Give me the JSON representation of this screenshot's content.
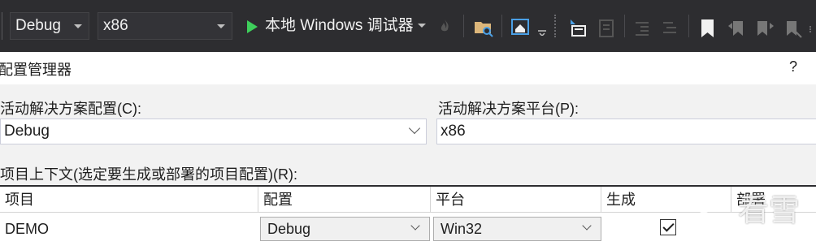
{
  "toolbar": {
    "config_value": "Debug",
    "platform_value": "x86",
    "run_label": "本地 Windows 调试器"
  },
  "dialog": {
    "title": "配置管理器",
    "help": "?",
    "active_config_label": "活动解决方案配置(C):",
    "active_config_value": "Debug",
    "active_platform_label": "活动解决方案平台(P):",
    "active_platform_value": "x86",
    "project_context_label": "项目上下文(选定要生成或部署的项目配置)(R):",
    "columns": [
      "项目",
      "配置",
      "平台",
      "生成",
      "部署"
    ],
    "rows": [
      {
        "project": "DEMO",
        "config": "Debug",
        "platform": "Win32",
        "build": true,
        "deploy": false
      }
    ]
  },
  "watermark": {
    "text": "看雪"
  }
}
